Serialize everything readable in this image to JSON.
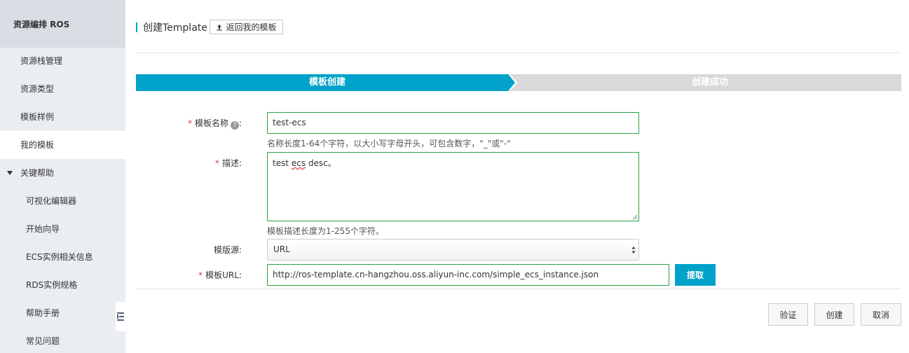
{
  "sidebar": {
    "header": "资源编排 ROS",
    "items": [
      {
        "label": "资源栈管理"
      },
      {
        "label": "资源类型"
      },
      {
        "label": "模板样例"
      },
      {
        "label": "我的模板"
      },
      {
        "label": "关键帮助"
      },
      {
        "label": "可视化编辑器"
      },
      {
        "label": "开始向导"
      },
      {
        "label": "ECS实例相关信息"
      },
      {
        "label": "RDS实例规格"
      },
      {
        "label": "帮助手册"
      },
      {
        "label": "常见问题"
      }
    ],
    "active_item": "我的模板",
    "expanded_group": "关键帮助"
  },
  "header": {
    "title": "创建Template",
    "back_label": "返回我的模板"
  },
  "steps": [
    {
      "label": "模板创建",
      "active": true
    },
    {
      "label": "创建成功",
      "active": false
    }
  ],
  "form": {
    "name": {
      "label": "模板名称",
      "colon": ":",
      "value": "test-ecs",
      "hint": "名称长度1-64个字符，以大小写字母开头，可包含数字，\"_\"或\"-\""
    },
    "desc": {
      "label": "描述:",
      "value_pre": "test ",
      "value_spell": "ecs",
      "value_post": " desc。",
      "hint": "模板描述长度为1-255个字符。"
    },
    "source": {
      "label": "模版源:",
      "selected": "URL"
    },
    "url": {
      "label": "模板URL:",
      "value": "http://ros-template.cn-hangzhou.oss.aliyun-inc.com/simple_ecs_instance.json",
      "fetch_label": "提取"
    }
  },
  "actions": {
    "validate": "验证",
    "create": "创建",
    "cancel": "取消"
  },
  "colors": {
    "accent": "#00a2ca",
    "valid_border": "#2aa33f",
    "required": "#e4393c",
    "sidebar_bg": "#eaedf1"
  }
}
